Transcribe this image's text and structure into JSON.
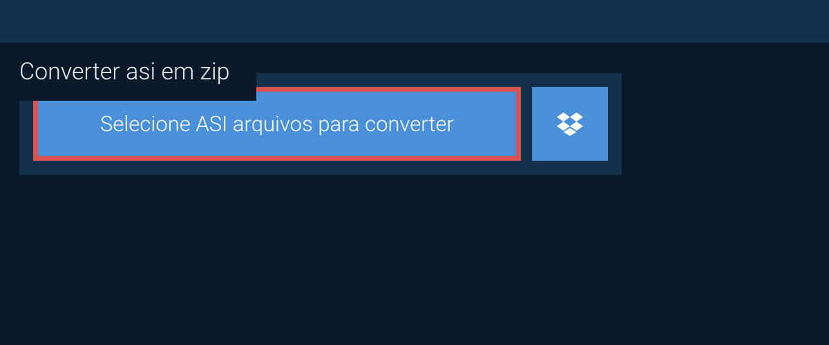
{
  "tab": {
    "title": "Converter asi em zip"
  },
  "actions": {
    "select_label": "Selecione ASI arquivos para converter"
  }
}
